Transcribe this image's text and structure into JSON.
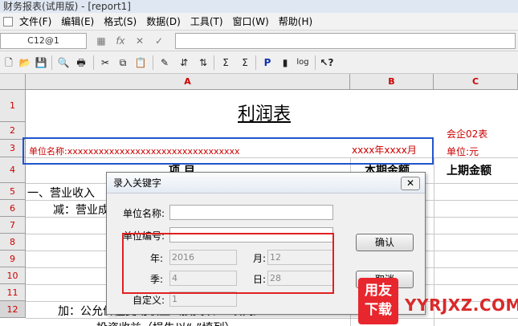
{
  "window": {
    "title": "财务报表(试用版) - [report1]"
  },
  "menu": {
    "items": [
      "文件(F)",
      "编辑(E)",
      "格式(S)",
      "数据(D)",
      "工具(T)",
      "窗口(W)",
      "帮助(H)"
    ]
  },
  "formula_bar": {
    "cell_ref": "C12@1",
    "value": ""
  },
  "sheet": {
    "columns": [
      "A",
      "B",
      "C"
    ],
    "rows": [
      "1",
      "2",
      "3",
      "4",
      "5",
      "6",
      "7",
      "8",
      "9",
      "10",
      "11",
      "12"
    ],
    "title": "利润表",
    "form_code": "会企02表",
    "unit_name_label": "单位名称:xxxxxxxxxxxxxxxxxxxxxxxxxxxxxxxxx",
    "date_text": "xxxx年xxxx月",
    "unit_label": "单位:元",
    "header_item": "项  目",
    "header_current": "本期金额",
    "header_previous": "上期金额",
    "row_revenue": "一、营业收入",
    "row_minus": "减：营业成",
    "row_add": "加：公允价值变动收益（损失以“-”填列）",
    "row_invest": "投资收益（损失以“-”填列）"
  },
  "dialog": {
    "title": "录入关键字",
    "close": "✕",
    "unit_name_label": "单位名称:",
    "unit_name_value": "",
    "unit_code_label": "单位编号:",
    "unit_code_value": "",
    "year_label": "年:",
    "year_value": "2016",
    "month_label": "月:",
    "month_value": "12",
    "quarter_label": "季:",
    "quarter_value": "4",
    "day_label": "日:",
    "day_value": "28",
    "custom_label": "自定义:",
    "custom_value": "1",
    "ok_button": "确认",
    "cancel_button": "取消"
  },
  "watermark": {
    "badge_line1": "用友",
    "badge_line2": "下载",
    "site": "YYRJXZ.COM"
  },
  "colors": {
    "accent_blue": "#2255cc",
    "highlight_red": "#e02020",
    "header_text_red": "#cc0000"
  }
}
